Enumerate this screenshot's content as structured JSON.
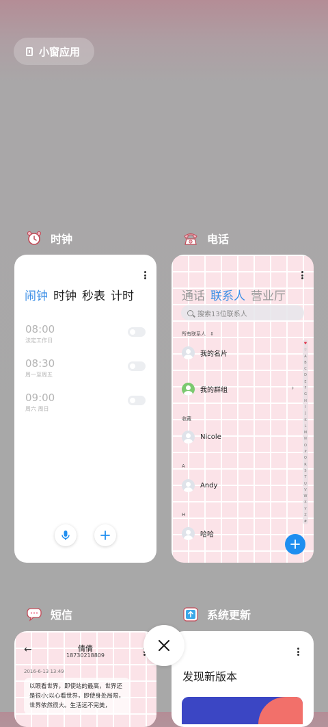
{
  "floating_window": {
    "label": "小窗应用"
  },
  "clock_app": {
    "title": "时钟",
    "tabs": [
      "闹钟",
      "时钟",
      "秒表",
      "计时"
    ],
    "alarms": [
      {
        "time": "08:00",
        "repeat": "法定工作日"
      },
      {
        "time": "08:30",
        "repeat": "周一至周五"
      },
      {
        "time": "09:00",
        "repeat": "周六 周日"
      }
    ]
  },
  "phone_app": {
    "title": "电话",
    "tabs": [
      "通话",
      "联系人",
      "营业厅"
    ],
    "search_placeholder": "搜索13位联系人",
    "all_contacts_label": "所有联系人",
    "contacts": [
      {
        "section": "",
        "name": "我的名片"
      },
      {
        "section": "",
        "name": "我的群组"
      },
      {
        "section": "收藏",
        "name": "Nicole"
      },
      {
        "section": "A",
        "name": "Andy"
      },
      {
        "section": "H",
        "name": "哈哈"
      }
    ],
    "index_letters": [
      "♥",
      "☆",
      "A",
      "B",
      "C",
      "D",
      "E",
      "F",
      "G",
      "H",
      "I",
      "J",
      "K",
      "L",
      "M",
      "N",
      "O",
      "P",
      "Q",
      "R",
      "S",
      "T",
      "U",
      "V",
      "W",
      "X",
      "Y",
      "Z",
      "#"
    ]
  },
  "sms_app": {
    "title": "短信",
    "contact_name": "倩倩",
    "contact_number": "18730218809",
    "timestamp": "2016-6-13 13:49",
    "message": "以眼看世界，即使站的最高，世界还是很小;以心看世界，即使身处局限，世界依然很大。生活远不完美，"
  },
  "update_app": {
    "title": "系统更新",
    "heading": "发现新版本"
  },
  "colors": {
    "accent": "#3a8ee6",
    "fab": "#1e8ef0",
    "group_avatar": "#7bc96f"
  }
}
